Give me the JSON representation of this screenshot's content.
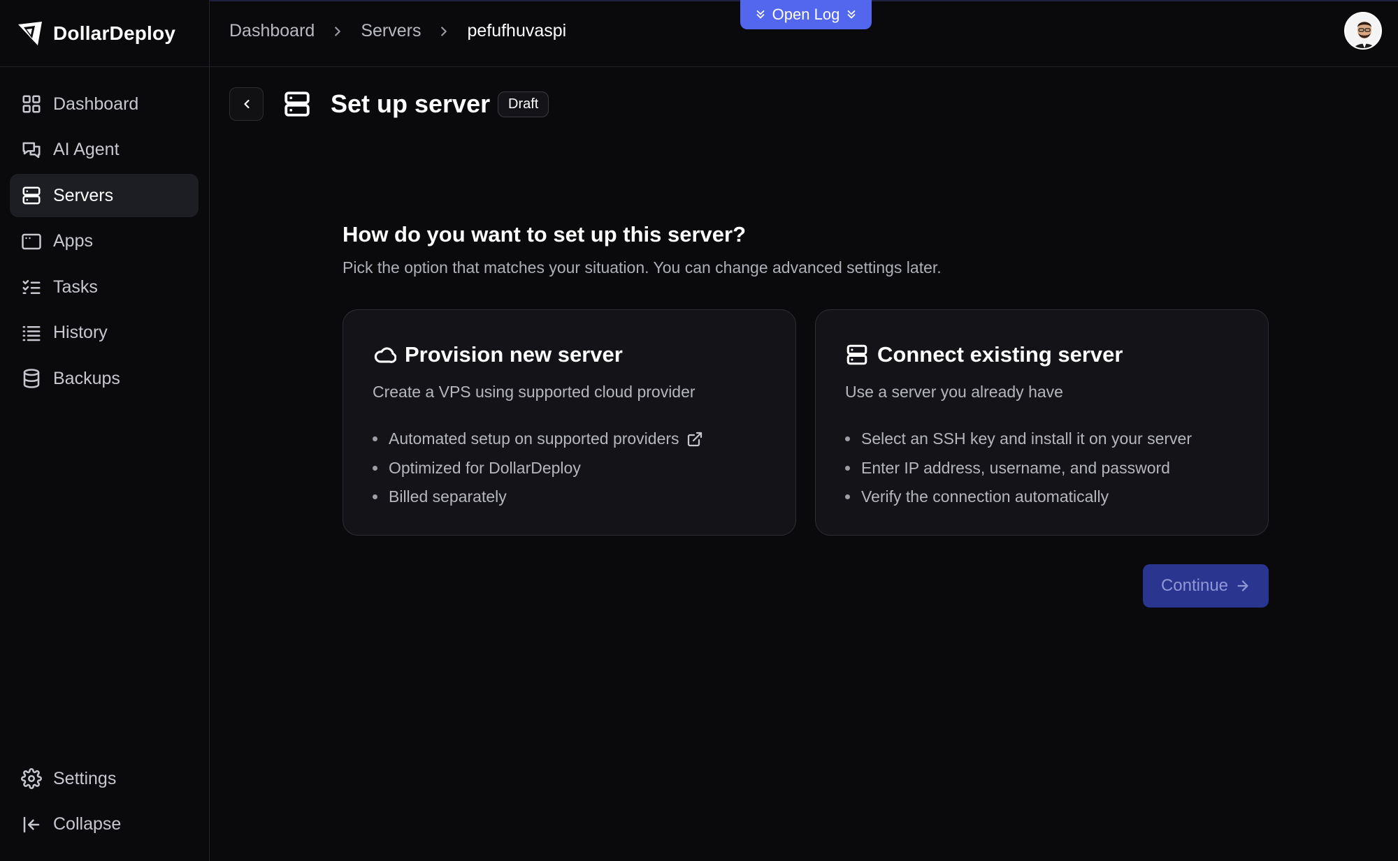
{
  "brand": {
    "name": "DollarDeploy"
  },
  "sidebar": {
    "items": [
      {
        "label": "Dashboard",
        "icon": "grid-icon"
      },
      {
        "label": "AI Agent",
        "icon": "chat-icon"
      },
      {
        "label": "Servers",
        "icon": "server-icon",
        "active": true
      },
      {
        "label": "Apps",
        "icon": "app-window-icon"
      },
      {
        "label": "Tasks",
        "icon": "task-list-icon"
      },
      {
        "label": "History",
        "icon": "list-icon"
      },
      {
        "label": "Backups",
        "icon": "database-icon"
      }
    ],
    "bottom": [
      {
        "label": "Settings",
        "icon": "gear-icon"
      },
      {
        "label": "Collapse",
        "icon": "collapse-icon"
      }
    ]
  },
  "header": {
    "breadcrumb": [
      "Dashboard",
      "Servers",
      "pefufhuvaspi"
    ],
    "open_log_label": "Open Log"
  },
  "page": {
    "title": "Set up server",
    "badge": "Draft",
    "question": "How do you want to set up this server?",
    "question_sub": "Pick the option that matches your situation. You can change advanced settings later."
  },
  "options": [
    {
      "title": "Provision new server",
      "icon": "cloud-icon",
      "subtitle": "Create a VPS using supported cloud provider",
      "bullets": [
        "Automated setup on supported providers",
        "Optimized for DollarDeploy",
        "Billed separately"
      ]
    },
    {
      "title": "Connect existing server",
      "icon": "server-icon",
      "subtitle": "Use a server you already have",
      "bullets": [
        "Select an SSH key and install it on your server",
        "Enter IP address, username, and password",
        "Verify the connection automatically"
      ]
    }
  ],
  "actions": {
    "continue_label": "Continue"
  },
  "colors": {
    "accent": "#5266ee",
    "button_disabled": "#2a3590",
    "background": "#0a0a0c",
    "card": "#141418"
  }
}
